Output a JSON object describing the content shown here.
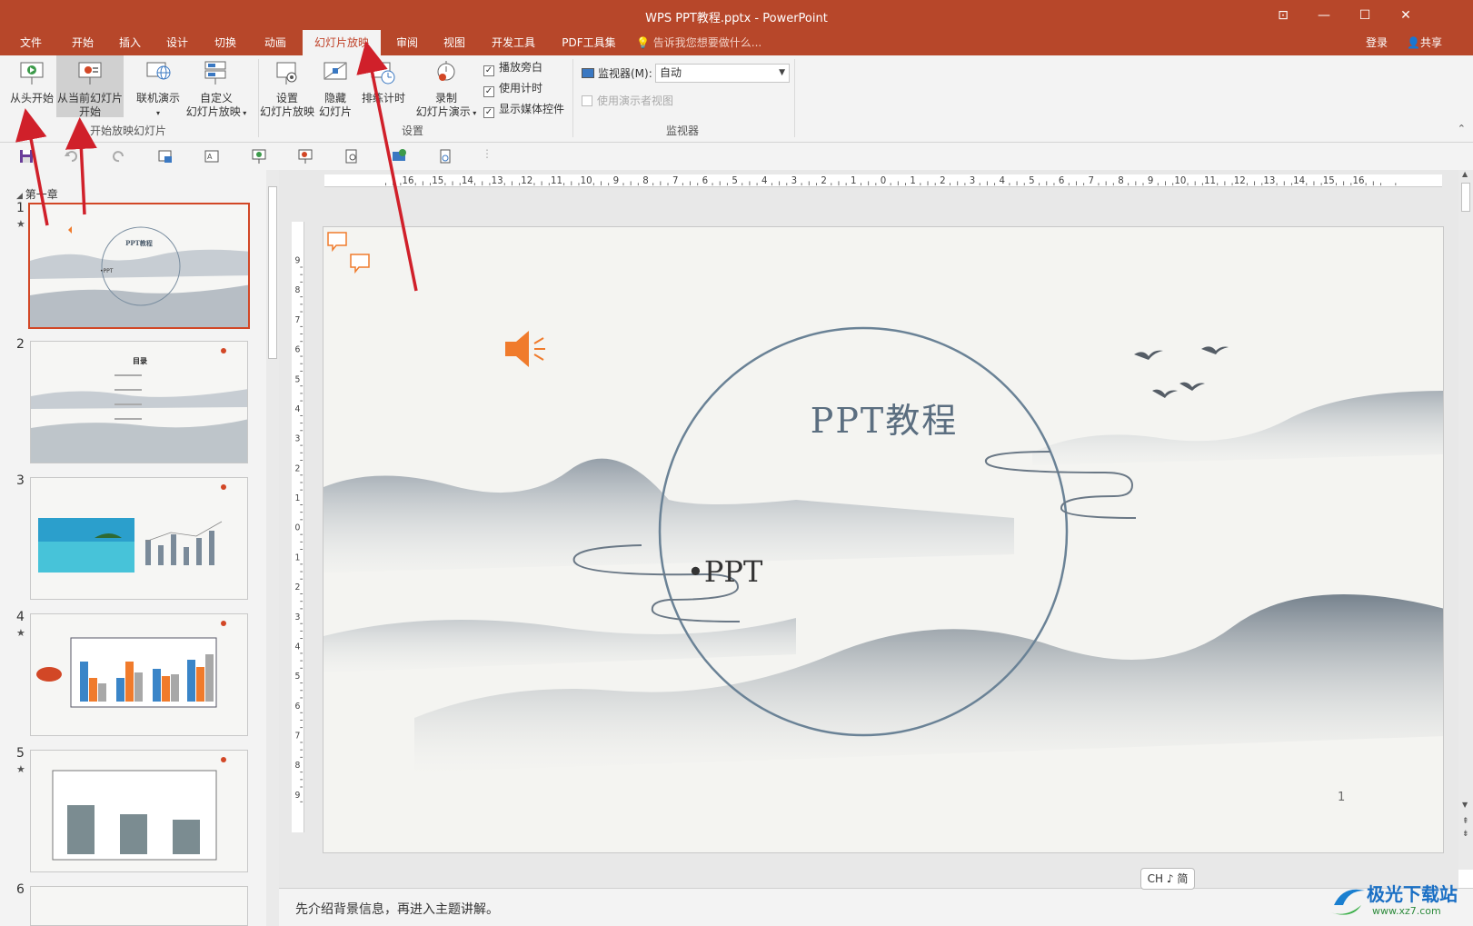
{
  "window": {
    "title": "WPS PPT教程.pptx - PowerPoint",
    "controls": [
      "⊡",
      "—",
      "☐",
      "✕"
    ]
  },
  "tabs": [
    "文件",
    "开始",
    "插入",
    "设计",
    "切换",
    "动画",
    "幻灯片放映",
    "审阅",
    "视图",
    "开发工具",
    "PDF工具集"
  ],
  "active_tab": "幻灯片放映",
  "tell_me": "告诉我您想要做什么...",
  "account": {
    "login": "登录",
    "share": "共享"
  },
  "ribbon": {
    "start_group": {
      "label": "开始放映幻灯片",
      "from_beginning": "从头开始",
      "from_current_l1": "从当前幻灯片",
      "from_current_l2": "开始",
      "online_l1": "联机演示",
      "custom_l1": "自定义",
      "custom_l2": "幻灯片放映"
    },
    "setup_group": {
      "label": "设置",
      "setup_l1": "设置",
      "setup_l2": "幻灯片放映",
      "hide_l1": "隐藏",
      "hide_l2": "幻灯片",
      "rehearse": "排练计时",
      "record_l1": "录制",
      "record_l2": "幻灯片演示",
      "play_narration": "播放旁白",
      "use_timings": "使用计时",
      "show_media_controls": "显示媒体控件"
    },
    "monitor_group": {
      "label": "监视器",
      "monitor_label": "监视器(M):",
      "monitor_value": "自动",
      "presenter_view": "使用演示者视图"
    }
  },
  "section": {
    "name": "第一章"
  },
  "thumbnails": [
    {
      "num": "1",
      "star": "★",
      "title": "PPT教程",
      "sub": "•PPT"
    },
    {
      "num": "2",
      "star": "",
      "title": "目录"
    },
    {
      "num": "3",
      "star": ""
    },
    {
      "num": "4",
      "star": "★"
    },
    {
      "num": "5",
      "star": "★"
    },
    {
      "num": "6",
      "star": ""
    }
  ],
  "slide": {
    "title": "PPT教程",
    "subtitle": "•PPT",
    "page_number": "1"
  },
  "notes": "先介绍背景信息，再进入主题讲解。",
  "ime": "CH ♪ 简",
  "watermark": {
    "name": "极光下载站",
    "url": "www.xz7.com"
  },
  "colors": {
    "title_bar": "#b7472a",
    "accent": "#d24726",
    "annotation_arrow": "#d0202a"
  }
}
